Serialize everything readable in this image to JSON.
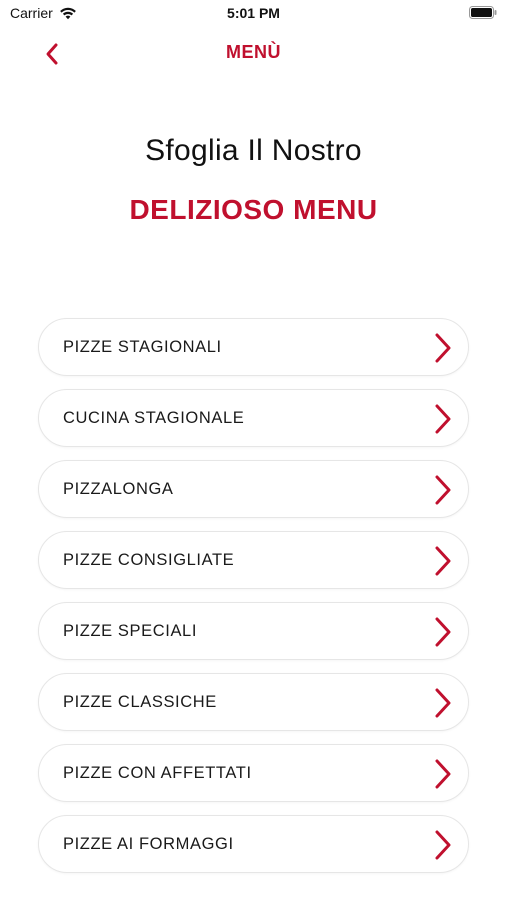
{
  "status_bar": {
    "carrier": "Carrier",
    "time": "5:01 PM"
  },
  "nav": {
    "title": "MENÙ",
    "back_icon": "chevron-left-icon"
  },
  "hero": {
    "line1": "Sfoglia Il Nostro",
    "line2": "DELIZIOSO MENU"
  },
  "menu": {
    "items": [
      {
        "label": "PIZZE STAGIONALI"
      },
      {
        "label": "CUCINA STAGIONALE"
      },
      {
        "label": "PIZZALONGA"
      },
      {
        "label": "PIZZE CONSIGLIATE"
      },
      {
        "label": "PIZZE SPECIALI"
      },
      {
        "label": "PIZZE CLASSICHE"
      },
      {
        "label": "PIZZE CON AFFETTATI"
      },
      {
        "label": "PIZZE AI FORMAGGI"
      }
    ],
    "item_icon": "chevron-right-icon"
  },
  "colors": {
    "accent": "#c0102e",
    "text": "#111111",
    "border": "#e6e6e6",
    "background": "#ffffff"
  }
}
